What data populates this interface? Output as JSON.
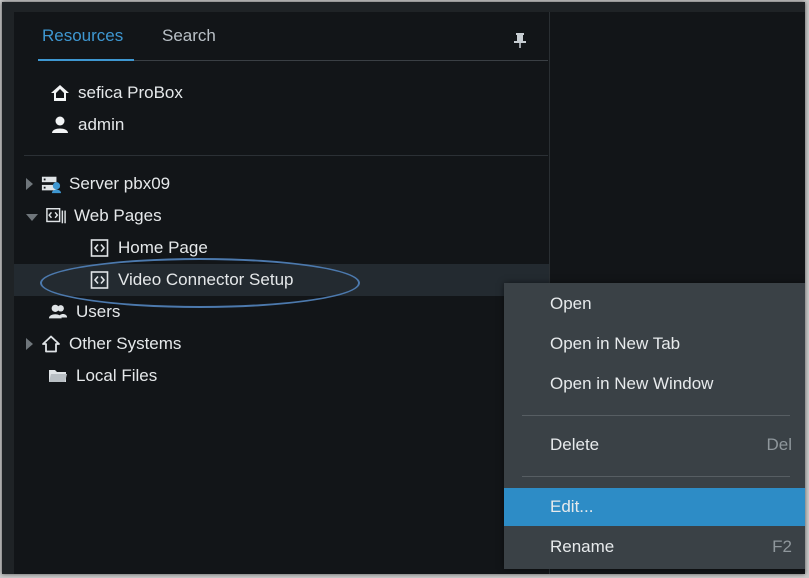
{
  "tabs": [
    {
      "label": "Resources"
    },
    {
      "label": "Search"
    }
  ],
  "header": {
    "product": "sefica ProBox",
    "user": "admin"
  },
  "tree": {
    "server": "Server pbx09",
    "web_pages": "Web Pages",
    "home_page": "Home Page",
    "video_connector": "Video Connector Setup",
    "users": "Users",
    "other_systems": "Other Systems",
    "local_files": "Local Files"
  },
  "context_menu": {
    "open": "Open",
    "open_new_tab": "Open in New Tab",
    "open_new_window": "Open in New Window",
    "delete": "Delete",
    "delete_shortcut": "Del",
    "edit": "Edit...",
    "rename": "Rename",
    "rename_shortcut": "F2"
  },
  "colors": {
    "accent": "#3e97d1",
    "menu_active": "#2d8cc6",
    "background": "#121518"
  }
}
